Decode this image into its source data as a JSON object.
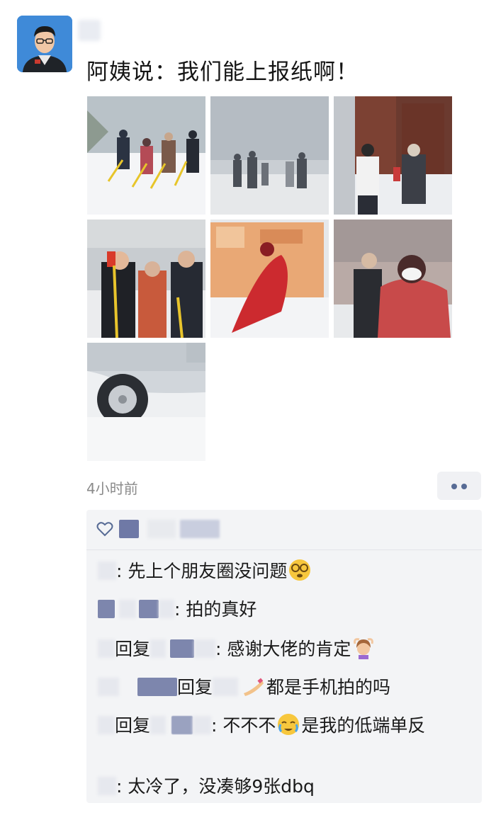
{
  "post": {
    "text": "阿姨说：我们能上报纸啊！",
    "time": "4小时前"
  },
  "photos": [
    {
      "subject": "people-shoveling-snow"
    },
    {
      "subject": "people-walking-in-snowstorm"
    },
    {
      "subject": "two-women-at-doorway"
    },
    {
      "subject": "group-with-shovels"
    },
    {
      "subject": "person-in-red-coat-shoveling"
    },
    {
      "subject": "woman-in-red-coat-mask"
    },
    {
      "subject": "car-wheel-in-snow"
    }
  ],
  "comments": [
    {
      "sep": ":",
      "text": " 先上个朋友圈没问题",
      "emoji": "dizzy-face-emoji"
    },
    {
      "sep": ":",
      "text": " 拍的真好"
    },
    {
      "reply": "回复",
      "sep": ":",
      "text": " 感谢大佬的肯定",
      "emoji": "woman-gesturing-ok-emoji"
    },
    {
      "reply": "回复",
      "emoji": "nail-polish-emoji",
      "text": "都是手机拍的吗"
    },
    {
      "reply": "回复",
      "sep": ":",
      "text_a": " 不不不",
      "emoji": "crying-face-emoji",
      "text_b": "是我的低端单反"
    },
    {
      "sep": ":",
      "text": " 太冷了，没凑够9张dbq"
    }
  ],
  "icons": {
    "like": "heart-icon",
    "more": "more-dots-icon"
  },
  "colors": {
    "link": "#576b95",
    "panel": "#f3f4f6",
    "time": "#8a8a8a"
  }
}
